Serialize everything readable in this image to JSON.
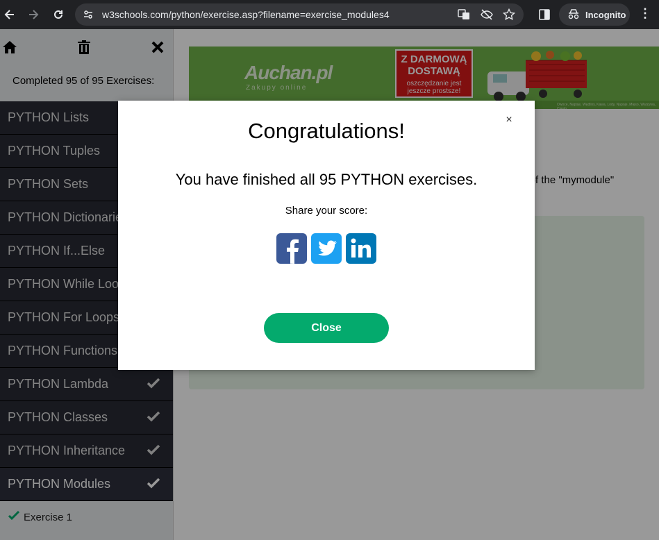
{
  "browser": {
    "url": "w3schools.com/python/exercise.asp?filename=exercise_modules4",
    "incognito_label": "Incognito"
  },
  "sidebar": {
    "completed_text": "Completed 95 of 95 Exercises:",
    "items": [
      {
        "label": "PYTHON Lists"
      },
      {
        "label": "PYTHON Tuples"
      },
      {
        "label": "PYTHON Sets"
      },
      {
        "label": "PYTHON Dictionaries"
      },
      {
        "label": "PYTHON If...Else"
      },
      {
        "label": "PYTHON While Loops"
      },
      {
        "label": "PYTHON For Loops"
      },
      {
        "label": "PYTHON Functions"
      },
      {
        "label": "PYTHON Lambda"
      },
      {
        "label": "PYTHON Classes"
      },
      {
        "label": "PYTHON Inheritance"
      },
      {
        "label": "PYTHON Modules"
      }
    ],
    "sub_item": "Exercise 1"
  },
  "ad": {
    "logo": "Auchan.pl",
    "logo_sub": "Zakupy online",
    "headline": "Z DARMOWĄ DOSTAWĄ",
    "tagline": "oszczędzanie jest jeszcze prostsze!",
    "fine_print": "Owoce, Napoje, Wędliny, Kawa, Lody, Napoje, Mięso, Warzywa, Ciasto"
  },
  "main": {
    "task_text": "ry of the \"mymodule\""
  },
  "modal": {
    "title": "Congratulations!",
    "message": "You have finished all 95 PYTHON exercises.",
    "share_label": "Share your score:",
    "close_label": "Close",
    "x_label": "×"
  },
  "colors": {
    "accent": "#04aa6d",
    "sidebar_dark": "#282a35",
    "facebook": "#3b5998",
    "twitter": "#1da1f2",
    "linkedin": "#0077b5"
  }
}
